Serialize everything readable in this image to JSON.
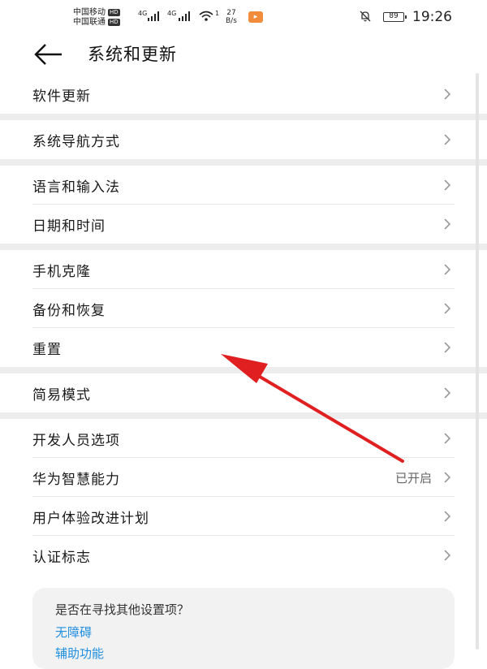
{
  "status_bar": {
    "carrier1": "中国移动",
    "carrier2": "中国联通",
    "hd": "HD",
    "net1": "4G",
    "net2": "4G",
    "wifi_sub": "1",
    "speed_value": "27",
    "speed_unit": "B/s",
    "battery": "89",
    "time": "19:26"
  },
  "header": {
    "title": "系统和更新",
    "back_icon": "arrow-left-icon"
  },
  "groups": [
    {
      "items": [
        {
          "label": "软件更新",
          "value": ""
        }
      ]
    },
    {
      "items": [
        {
          "label": "系统导航方式",
          "value": ""
        }
      ]
    },
    {
      "items": [
        {
          "label": "语言和输入法",
          "value": ""
        },
        {
          "label": "日期和时间",
          "value": ""
        }
      ]
    },
    {
      "items": [
        {
          "label": "手机克隆",
          "value": ""
        },
        {
          "label": "备份和恢复",
          "value": ""
        },
        {
          "label": "重置",
          "value": ""
        }
      ]
    },
    {
      "items": [
        {
          "label": "简易模式",
          "value": ""
        }
      ]
    },
    {
      "items": [
        {
          "label": "开发人员选项",
          "value": ""
        },
        {
          "label": "华为智慧能力",
          "value": "已开启"
        },
        {
          "label": "用户体验改进计划",
          "value": ""
        },
        {
          "label": "认证标志",
          "value": ""
        }
      ]
    }
  ],
  "suggestion": {
    "question": "是否在寻找其他设置项？",
    "link1": "无障碍",
    "link2": "辅助功能"
  },
  "colors": {
    "annotation_arrow": "#e02020",
    "link": "#1f8fe0",
    "separator": "#ededed",
    "battery_bg": "#f08c3c"
  }
}
